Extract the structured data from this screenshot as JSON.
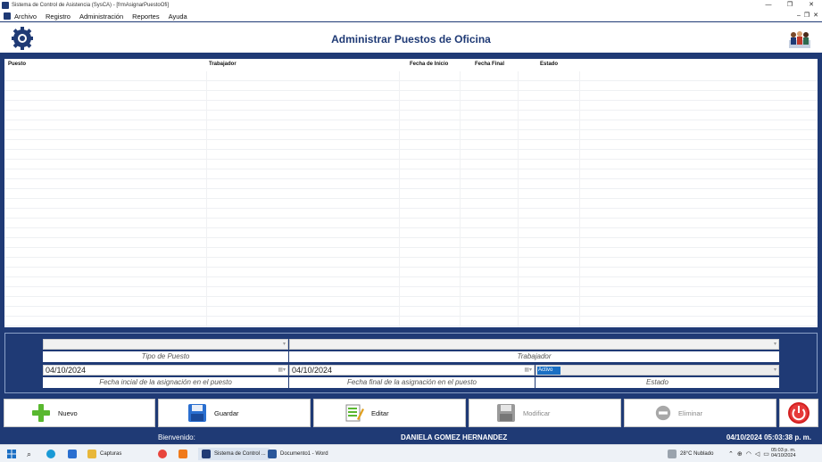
{
  "window": {
    "title": "Sistema de Control de Asistencia (SysCA) - [frmAsignarPuestoOfi]",
    "controls": [
      "—",
      "❐",
      "✕"
    ],
    "mdi_controls": [
      "–",
      "❐",
      "✕"
    ]
  },
  "menu": {
    "items": [
      "Archivo",
      "Registro",
      "Administración",
      "Reportes",
      "Ayuda"
    ]
  },
  "header": {
    "title": "Administrar Puestos de Oficina"
  },
  "grid": {
    "columns": [
      "Puesto",
      "Trabajador",
      "Fecha de Inicio",
      "Fecha Final",
      "Estado"
    ]
  },
  "form": {
    "tipo_puesto_caption": "Tipo de Puesto",
    "trabajador_caption": "Trabajador",
    "fecha_inicio_value": "04/10/2024",
    "fecha_inicio_caption": "Fecha incial de la asignación en el puesto",
    "fecha_final_value": "04/10/2024",
    "fecha_final_caption": "Fecha final de la asignación en el puesto",
    "estado_selected": "Activo",
    "estado_caption": "Estado"
  },
  "buttons": {
    "nuevo": "Nuevo",
    "guardar": "Guardar",
    "editar": "Editar",
    "modificar": "Modificar",
    "eliminar": "Eliminar"
  },
  "status": {
    "welcome": "Bienvenido:",
    "user": "DANIELA GOMEZ HERNANDEZ",
    "datetime": "04/10/2024 05:03:38 p. m."
  },
  "taskbar": {
    "capturas": "Capturas",
    "app_task": "Sistema de Control ...",
    "word_task": "Documento1 - Word",
    "weather": "28°C  Nublado",
    "time": "05:03 p. m.",
    "date": "04/10/2024"
  },
  "colors": {
    "brand": "#1f3a75",
    "accent": "#1a6fc4",
    "power": "#d32020",
    "nuevo_green": "#59b82f"
  }
}
